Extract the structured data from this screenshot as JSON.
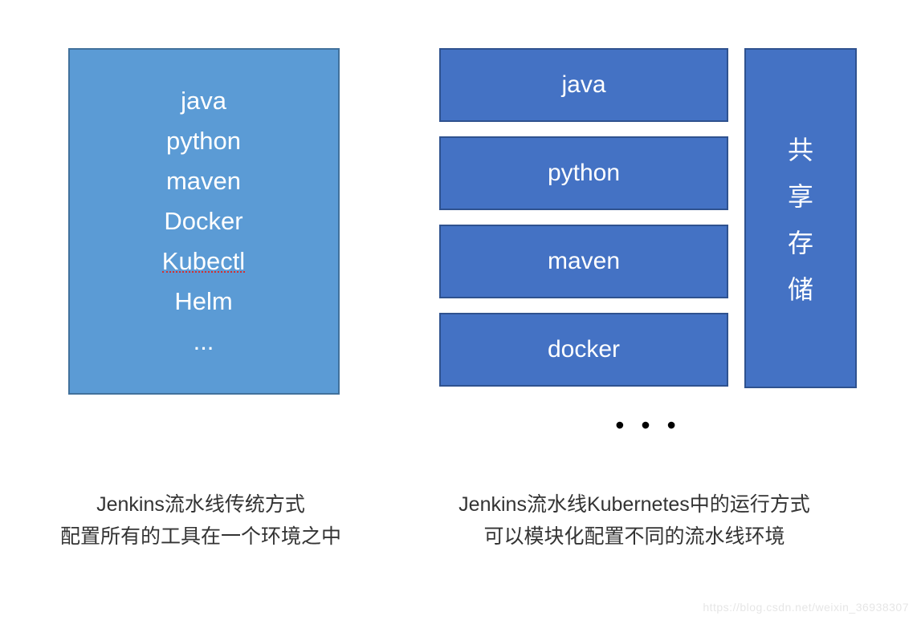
{
  "left": {
    "items": [
      "java",
      "python",
      "maven",
      "Docker",
      "Kubectl",
      "Helm",
      "..."
    ],
    "caption_line1": "Jenkins流水线传统方式",
    "caption_line2": "配置所有的工具在一个环境之中"
  },
  "right": {
    "modules": [
      "java",
      "python",
      "maven",
      "docker"
    ],
    "storage_chars": [
      "共",
      "享",
      "存",
      "储"
    ],
    "ellipsis": "•  •  •",
    "caption_line1": "Jenkins流水线Kubernetes中的运行方式",
    "caption_line2": "可以模块化配置不同的流水线环境"
  },
  "watermark": "https://blog.csdn.net/weixin_36938307"
}
